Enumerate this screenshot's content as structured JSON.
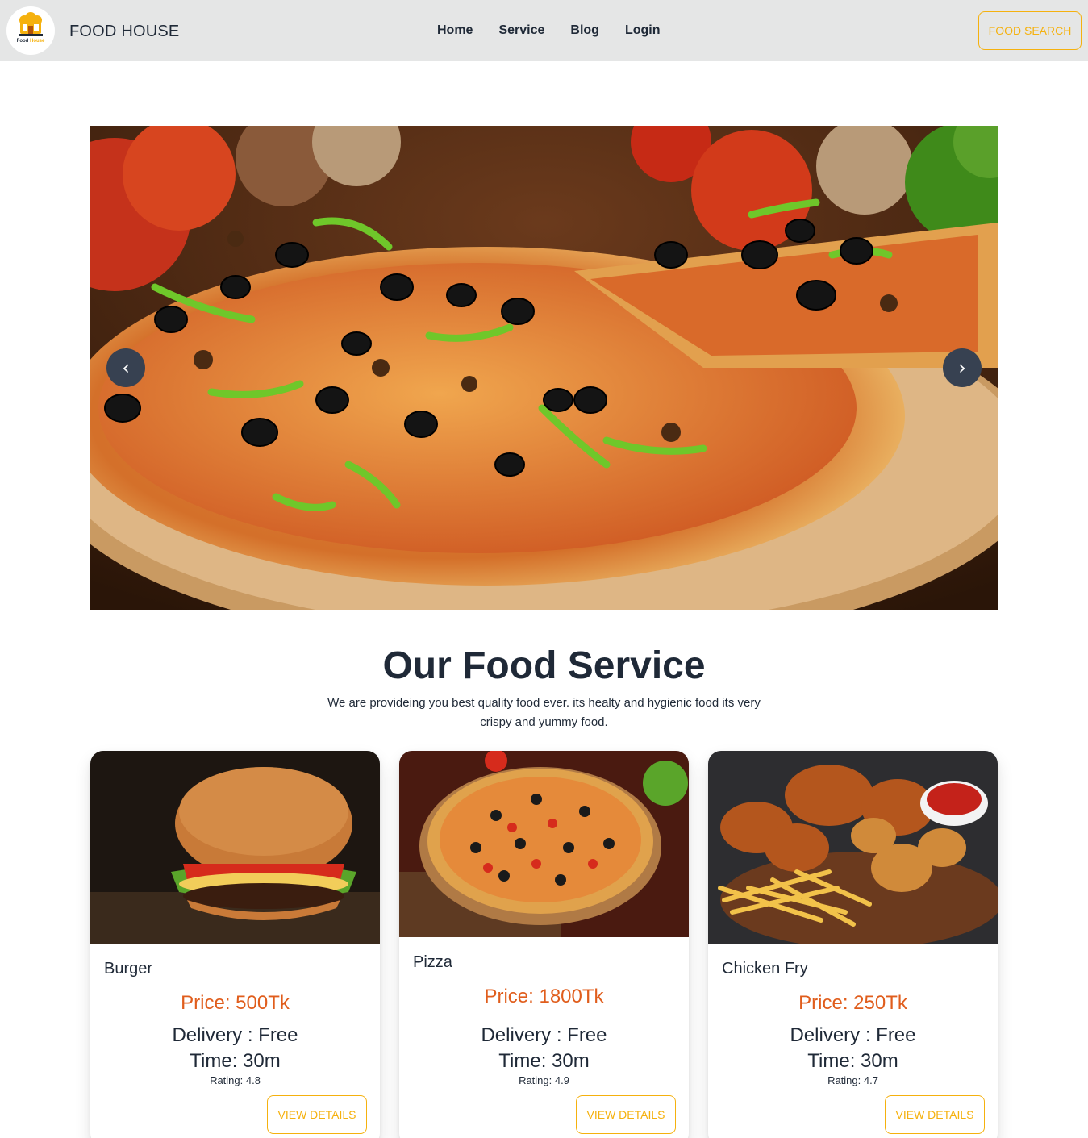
{
  "navbar": {
    "logo_text_left": "Food",
    "logo_text_right": "House",
    "brand": "FOOD HOUSE",
    "menu": [
      {
        "label": "Home"
      },
      {
        "label": "Service"
      },
      {
        "label": "Blog"
      },
      {
        "label": "Login"
      }
    ],
    "search_button": "FOOD SEARCH"
  },
  "hero": {
    "prev_icon": "chevron-left-icon",
    "next_icon": "chevron-right-icon",
    "prev_glyph": "‹",
    "next_glyph": "›"
  },
  "section": {
    "title": "Our Food Service",
    "subtitle": "We are provideing you best quality food ever. its healty and hygienic food its very crispy and yummy food."
  },
  "cards": [
    {
      "title": "Burger",
      "price": "Price: 500Tk",
      "delivery": "Delivery : Free",
      "time": "Time: 30m",
      "rating": "Rating: 4.8",
      "button": "VIEW DETAILS"
    },
    {
      "title": "Pizza",
      "price": "Price: 1800Tk",
      "delivery": "Delivery : Free",
      "time": "Time: 30m",
      "rating": "Rating: 4.9",
      "button": "VIEW DETAILS"
    },
    {
      "title": "Chicken Fry",
      "price": "Price: 250Tk",
      "delivery": "Delivery : Free",
      "time": "Time: 30m",
      "rating": "Rating: 4.7",
      "button": "VIEW DETAILS"
    }
  ],
  "colors": {
    "accent": "#f5b10e",
    "price": "#e05d1c",
    "navbar_bg": "#e5e6e6",
    "text": "#1f2937",
    "carousel_button": "#374151"
  }
}
